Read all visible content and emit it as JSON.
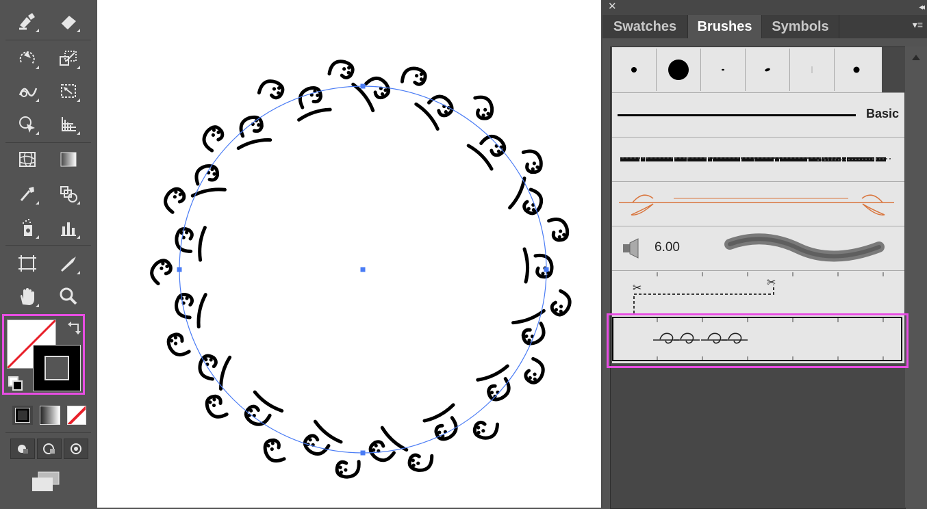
{
  "panel": {
    "tabs": [
      {
        "label": "Swatches"
      },
      {
        "label": "Brushes"
      },
      {
        "label": "Symbols"
      }
    ],
    "active_tab": "Brushes",
    "close_glyph": "✕",
    "collapse_glyph": "◂◂",
    "menu_glyph": "▾≡"
  },
  "brushes": {
    "basic_label": "Basic",
    "bristle_size": "6.00"
  },
  "icons": {
    "left": [
      "blob-brush-icon",
      "eraser-icon",
      "rotate-icon",
      "scale-icon",
      "warp-icon",
      "free-transform-icon",
      "shape-builder-icon",
      "perspective-grid-icon",
      "mesh-icon",
      "gradient-icon",
      "eyedropper-icon",
      "blend-icon",
      "symbol-sprayer-icon",
      "column-graph-icon",
      "artboard-icon",
      "slice-icon",
      "hand-icon",
      "zoom-icon"
    ]
  },
  "colors": {
    "highlight": "#e84de3",
    "path_blue": "#4a7cf5",
    "art_orange": "#d9753d"
  }
}
